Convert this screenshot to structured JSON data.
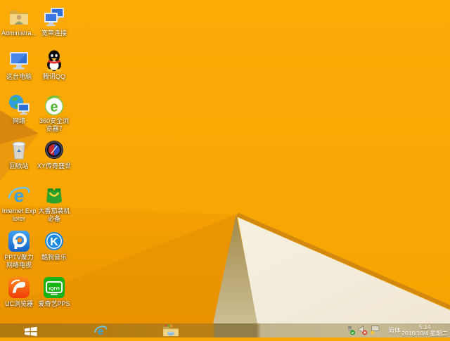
{
  "desktop": {
    "icons": [
      {
        "label": "Administra...",
        "icon": "administrator-folder-icon"
      },
      {
        "label": "宽带连接",
        "icon": "broadband-connection-icon"
      },
      {
        "label": "这台电脑",
        "icon": "this-pc-icon"
      },
      {
        "label": "腾讯QQ",
        "icon": "qq-penguin-icon"
      },
      {
        "label": "网络",
        "icon": "network-globe-icon"
      },
      {
        "label": "360安全浏览器7",
        "icon": "360-browser-icon"
      },
      {
        "label": "回收站",
        "icon": "recycle-bin-icon"
      },
      {
        "label": "XY传奇盛世",
        "icon": "xy-game-emblem-icon"
      },
      {
        "label": "Internet Explorer",
        "icon": "internet-explorer-icon"
      },
      {
        "label": "大番茄装机必备",
        "icon": "tomato-bag-icon"
      },
      {
        "label": "PPTV聚力 网络电视",
        "icon": "pptv-icon"
      },
      {
        "label": "酷狗音乐",
        "icon": "kugou-music-icon"
      },
      {
        "label": "UC浏览器",
        "icon": "uc-browser-icon"
      },
      {
        "label": "爱奇艺PPS",
        "icon": "iqiyi-pps-icon"
      }
    ]
  },
  "taskbar": {
    "buttons": [
      {
        "name": "start",
        "icon": "windows-start-icon"
      },
      {
        "name": "internet-explorer",
        "icon": "ie-taskbar-icon"
      },
      {
        "name": "file-explorer",
        "icon": "folder-explorer-icon"
      }
    ],
    "tray": {
      "usb_icon": "safely-remove-hardware-icon",
      "volume_icon": "volume-muted-icon",
      "network_icon": "network-warning-icon",
      "ime": "简体",
      "time": "5:14",
      "date": "2016/10/4 星期二"
    }
  },
  "colors": {
    "wallpaper_orange": "#f8a804",
    "wallpaper_fold_dark": "#df8d12",
    "wallpaper_shadow_olive": "#ab9254",
    "wallpaper_paper_white": "#f3ecda",
    "taskbar_orange": "#b37a12",
    "taskbar_olive": "#8f7d4a",
    "taskbar_tan": "#c2b48d"
  }
}
